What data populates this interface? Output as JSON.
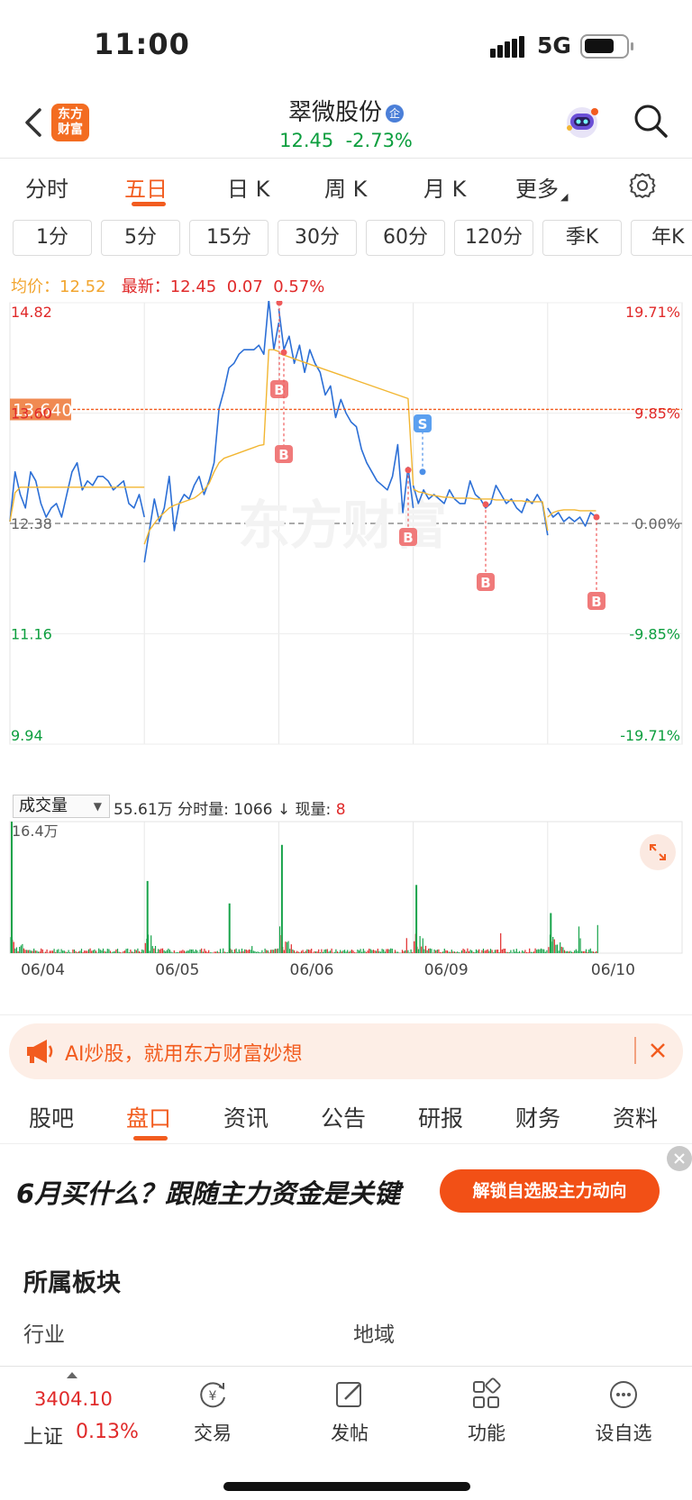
{
  "status_bar": {
    "time": "11:00",
    "network": "5G"
  },
  "header": {
    "logo_text": "东方\n财富",
    "stock_name": "翠微股份",
    "badge": "企",
    "price": "12.45",
    "change_pct": "-2.73%"
  },
  "period_tabs": [
    "分时",
    "五日",
    "日 K",
    "周 K",
    "月 K",
    "更多"
  ],
  "period_active": "五日",
  "minute_tabs": [
    "1分",
    "5分",
    "15分",
    "30分",
    "60分",
    "120分",
    "季K",
    "年K"
  ],
  "chart_info": {
    "avg_label": "均价：",
    "avg_value": "12.52",
    "latest_label": "最新：",
    "latest_value": "12.45",
    "latest_change": "0.07",
    "latest_pct": "0.57%"
  },
  "chart_data": {
    "type": "line",
    "title": "",
    "days": [
      "06/04",
      "06/05",
      "06/06",
      "06/09",
      "06/10"
    ],
    "y_axis_left": [
      "14.82",
      "13.60",
      "12.38",
      "11.16",
      "9.94"
    ],
    "y_axis_right": [
      "19.71%",
      "9.85%",
      "0.00%",
      "-9.85%",
      "-19.71%"
    ],
    "ylim": [
      9.94,
      14.82
    ],
    "prev_close": 12.38,
    "crosshair_price": "13.640",
    "watermark": "东方财富",
    "series": [
      {
        "name": "price",
        "color": "#2c6fd6",
        "values": [
          12.4,
          12.95,
          12.7,
          12.55,
          12.95,
          12.85,
          12.6,
          12.45,
          12.55,
          12.6,
          12.45,
          12.7,
          12.95,
          13.05,
          12.75,
          12.85,
          12.8,
          12.9,
          12.9,
          12.85,
          12.75,
          12.8,
          12.85,
          12.6,
          12.55,
          12.7,
          12.45,
          11.95,
          12.3,
          12.65,
          12.4,
          12.55,
          12.9,
          12.3,
          12.6,
          12.7,
          12.65,
          12.8,
          12.9,
          12.7,
          12.85,
          13.05,
          13.65,
          13.85,
          14.1,
          14.15,
          14.25,
          14.3,
          14.3,
          14.3,
          14.35,
          14.25,
          14.85,
          14.3,
          14.6,
          14.75,
          14.3,
          14.45,
          14.15,
          14.35,
          14.05,
          14.3,
          14.15,
          14.05,
          13.8,
          13.9,
          13.55,
          13.75,
          13.6,
          13.5,
          13.45,
          13.2,
          13.05,
          12.95,
          12.85,
          12.8,
          12.75,
          12.9,
          13.25,
          12.5,
          13.0,
          12.55,
          12.8,
          12.6,
          12.75,
          12.65,
          12.7,
          12.65,
          12.6,
          12.75,
          12.65,
          12.6,
          12.6,
          12.85,
          12.7,
          12.65,
          12.55,
          12.6,
          12.8,
          12.7,
          12.6,
          12.65,
          12.55,
          12.5,
          12.65,
          12.6,
          12.7,
          12.6,
          12.25,
          12.55,
          12.45,
          12.5,
          12.4,
          12.45,
          12.4,
          12.45,
          12.35,
          12.5,
          12.45
        ]
      },
      {
        "name": "average",
        "color": "#f2b632",
        "values": [
          12.4,
          12.72,
          12.78,
          12.78,
          12.78,
          12.78,
          12.78,
          12.78,
          12.78,
          12.78,
          12.78,
          12.78,
          12.78,
          12.78,
          12.78,
          12.78,
          12.78,
          12.78,
          12.78,
          12.78,
          12.78,
          12.78,
          12.78,
          12.78,
          12.78,
          12.78,
          12.78,
          12.15,
          12.3,
          12.38,
          12.45,
          12.5,
          12.55,
          12.58,
          12.6,
          12.62,
          12.64,
          12.66,
          12.7,
          12.75,
          12.82,
          12.95,
          13.05,
          13.1,
          13.12,
          13.14,
          13.16,
          13.18,
          13.2,
          13.22,
          13.24,
          13.25,
          14.3,
          14.3,
          14.28,
          14.26,
          14.24,
          14.22,
          14.2,
          14.18,
          14.16,
          14.14,
          14.12,
          14.1,
          14.08,
          14.06,
          14.04,
          14.02,
          14.0,
          13.98,
          13.96,
          13.94,
          13.92,
          13.9,
          13.88,
          13.86,
          13.84,
          13.82,
          13.8,
          13.78,
          13.76,
          12.8,
          12.76,
          12.73,
          12.72,
          12.7,
          12.69,
          12.68,
          12.67,
          12.67,
          12.66,
          12.66,
          12.66,
          12.66,
          12.65,
          12.65,
          12.65,
          12.65,
          12.64,
          12.64,
          12.64,
          12.63,
          12.63,
          12.63,
          12.62,
          12.62,
          12.62,
          12.62,
          12.3,
          12.45,
          12.5,
          12.52,
          12.53,
          12.53,
          12.53,
          12.52,
          12.52,
          12.52,
          12.52
        ]
      }
    ],
    "trade_markers": [
      {
        "label": "B",
        "day": "06/05",
        "price": 14.82
      },
      {
        "label": "B",
        "day": "06/05",
        "price": 14.27
      },
      {
        "label": "B",
        "day": "06/06",
        "price": 12.97
      },
      {
        "label": "S",
        "day": "06/06",
        "price": 12.95
      },
      {
        "label": "B",
        "day": "06/09",
        "price": 12.59
      },
      {
        "label": "B",
        "day": "06/10",
        "price": 12.45
      }
    ],
    "volume": {
      "max_label": "16.4万",
      "max": 16.4,
      "peaks": [
        16.4,
        9.0,
        6.2,
        13.5,
        8.5,
        5.0
      ]
    }
  },
  "volume_bar": {
    "selector": "成交量",
    "total": "55.61万",
    "minute_label": "分时量:",
    "minute_value": "1066",
    "arrow": "↓",
    "current_label": "现量:",
    "current_value": "8"
  },
  "ai_banner": {
    "text": "AI炒股，就用东方财富妙想"
  },
  "info_tabs": [
    "股吧",
    "盘口",
    "资讯",
    "公告",
    "研报",
    "财务",
    "资料"
  ],
  "info_active": "盘口",
  "ad": {
    "headline": "6月买什么？跟随主力资金是关键",
    "button": "解锁自选股主力动向"
  },
  "sector": {
    "title": "所属板块",
    "industry": "行业",
    "region": "地域"
  },
  "bottom_bar": {
    "index_value": "3404.10",
    "index_name": "上证",
    "index_change": "0.13%",
    "items": [
      "交易",
      "发帖",
      "功能",
      "设自选"
    ]
  },
  "colors": {
    "accent": "#f25c1f",
    "up": "#e02a2a",
    "down": "#0c9e3e",
    "price_line": "#2c6fd6",
    "avg_line": "#f2b632"
  }
}
